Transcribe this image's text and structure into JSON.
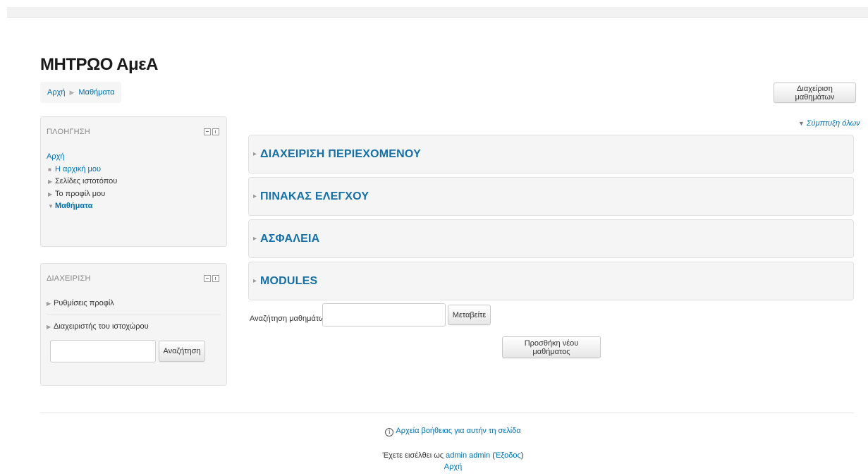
{
  "site": {
    "title": "ΜΗΤΡΩΟ ΑμεΑ"
  },
  "breadcrumb": {
    "home": "Αρχή",
    "separator": "▶",
    "current": "Μαθήματα"
  },
  "header_actions": {
    "manage_courses": "Διαχείριση μαθημάτων"
  },
  "navigation_block": {
    "title": "ΠΛΟΗΓΗΣΗ",
    "home": "Αρχή",
    "items": [
      {
        "label": "Η αρχική μου",
        "marker": "■"
      },
      {
        "label": "Σελίδες ιστοτόπου",
        "marker": "▶"
      },
      {
        "label": "Το προφίλ μου",
        "marker": "▶"
      },
      {
        "label": "Μαθήματα",
        "marker": "▼"
      }
    ]
  },
  "admin_block": {
    "title": "ΔΙΑΧΕΙΡΙΣΗ",
    "items": [
      {
        "label": "Ρυθμίσεις προφίλ",
        "marker": "▶"
      },
      {
        "label": "Διαχειριστής του ιστοχώρου",
        "marker": "▶"
      }
    ],
    "search_button": "Αναζήτηση",
    "search_value": ""
  },
  "main": {
    "collapse_all": "Σύμπτυξη όλων",
    "sections": [
      {
        "label": "ΔΙΑΧΕΙΡΙΣΗ ΠΕΡΙΕΧΟΜΕΝΟΥ"
      },
      {
        "label": "ΠΙΝΑΚΑΣ ΕΛΕΓΧΟΥ"
      },
      {
        "label": "ΑΣΦΑΛΕΙΑ"
      },
      {
        "label": "MODULES"
      }
    ],
    "course_search_label": "Αναζήτηση μαθημάτων:",
    "course_search_value": "",
    "go_button": "Μεταβείτε",
    "add_course_button": "Προσθήκη νέου μαθήματος"
  },
  "footer": {
    "help_link": "Αρχεία βοήθειας για αυτήν τη σελίδα",
    "logged_in_prefix": "Έχετε εισέλθει ως",
    "user_name": "admin admin",
    "logout_link": "Έξοδος",
    "home_link": "Αρχή"
  }
}
